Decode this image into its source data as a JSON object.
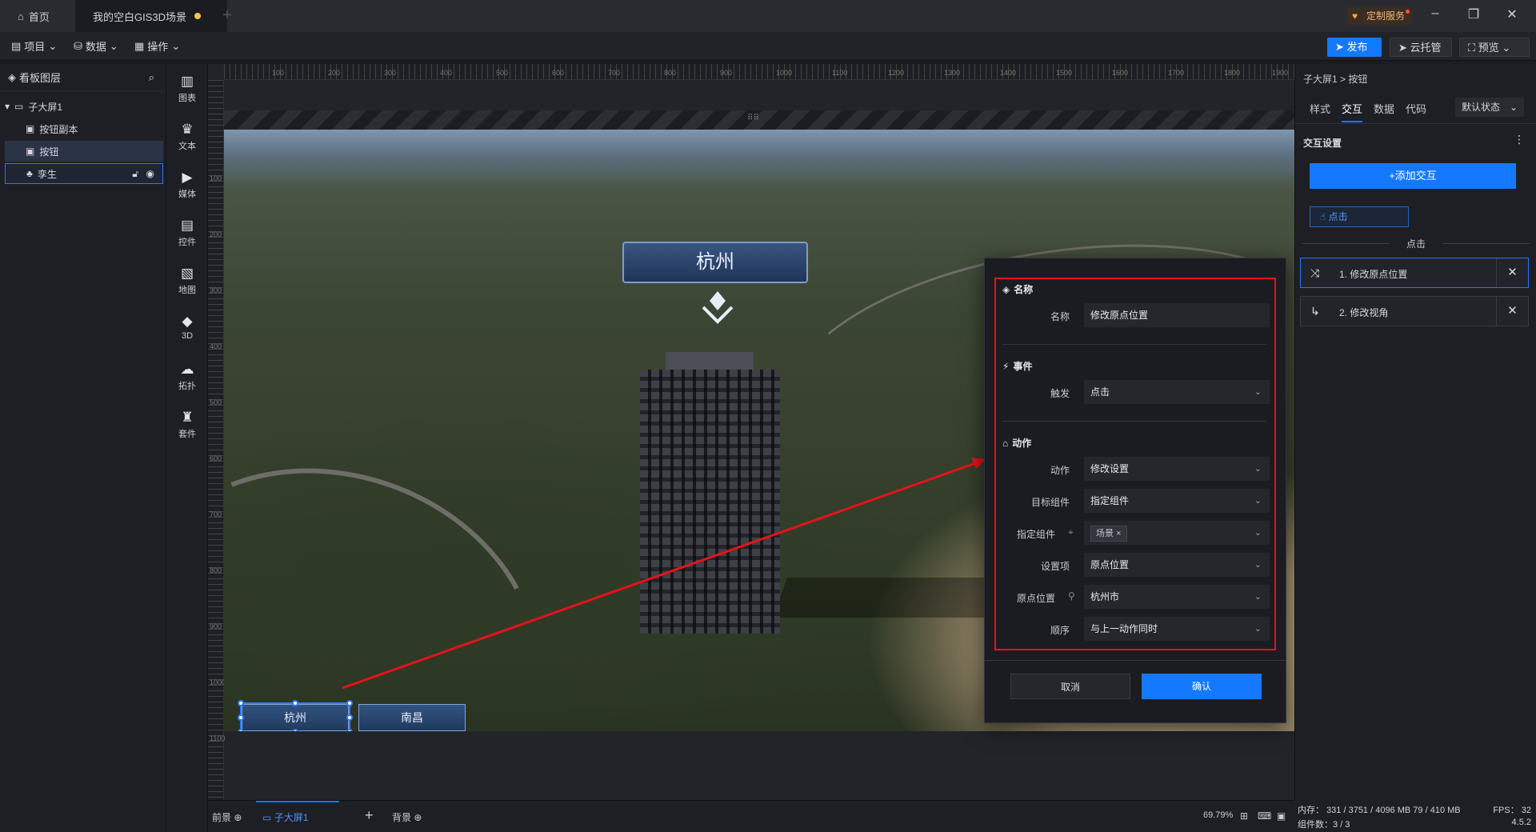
{
  "titlebar": {
    "home_tab": "首页",
    "project_tab": "我的空白GIS3D场景",
    "custom_service": "定制服务"
  },
  "toolbar": {
    "menu_project": "项目",
    "menu_data": "数据",
    "menu_operate": "操作",
    "publish": "发布",
    "cloud": "云托管",
    "preview": "预览"
  },
  "layers": {
    "title": "看板图层",
    "items": [
      "子大屏1",
      "按钮副本",
      "按钮",
      "孪生"
    ]
  },
  "components": [
    "图表",
    "文本",
    "媒体",
    "控件",
    "地图",
    "3D",
    "拓扑",
    "套件"
  ],
  "rulers": {
    "h": [
      "100",
      "200",
      "300",
      "400",
      "500",
      "600",
      "700",
      "800",
      "900",
      "1000",
      "1100",
      "1200",
      "1300",
      "1400",
      "1500",
      "1600",
      "1700",
      "1800",
      "1900"
    ],
    "v": [
      "100",
      "200",
      "300",
      "400",
      "500",
      "600",
      "700",
      "800",
      "900",
      "1000",
      "1100"
    ]
  },
  "scene": {
    "city_label": "杭州",
    "buttons": [
      "杭州",
      "南昌"
    ]
  },
  "dialog": {
    "sec_name": "名称",
    "sec_event": "事件",
    "sec_action": "动作",
    "fields": {
      "name_label": "名称",
      "name_value": "修改原点位置",
      "trigger_label": "触发",
      "trigger_value": "点击",
      "action_label": "动作",
      "action_value": "修改设置",
      "target_label": "目标组件",
      "target_value": "指定组件",
      "specified_label": "指定组件",
      "specified_tag": "场景",
      "setting_label": "设置项",
      "setting_value": "原点位置",
      "origin_label": "原点位置",
      "origin_value": "杭州市",
      "order_label": "顺序",
      "order_value": "与上一动作同时"
    },
    "cancel": "取消",
    "confirm": "确认"
  },
  "right": {
    "breadcrumb": "子大屏1 > 按钮",
    "tabs": [
      "样式",
      "交互",
      "数据",
      "代码"
    ],
    "state": "默认状态",
    "section": "交互设置",
    "add": "+添加交互",
    "click_chip": "点击",
    "divider": "点击",
    "actions": [
      "1. 修改原点位置",
      "2. 修改视角"
    ]
  },
  "bottom": {
    "tab_front": "前景",
    "tab_screen": "子大屏1",
    "tab_bg": "背景",
    "zoom": "69.79%"
  },
  "status": {
    "memory": "内存： 331 / 3751 / 4096 MB  79 / 410 MB",
    "fps": "FPS： 32",
    "count": "组件数：3 / 3",
    "version": "4.5.2"
  },
  "colors": {
    "accent": "#1479ff",
    "highlight": "#e5121c"
  }
}
